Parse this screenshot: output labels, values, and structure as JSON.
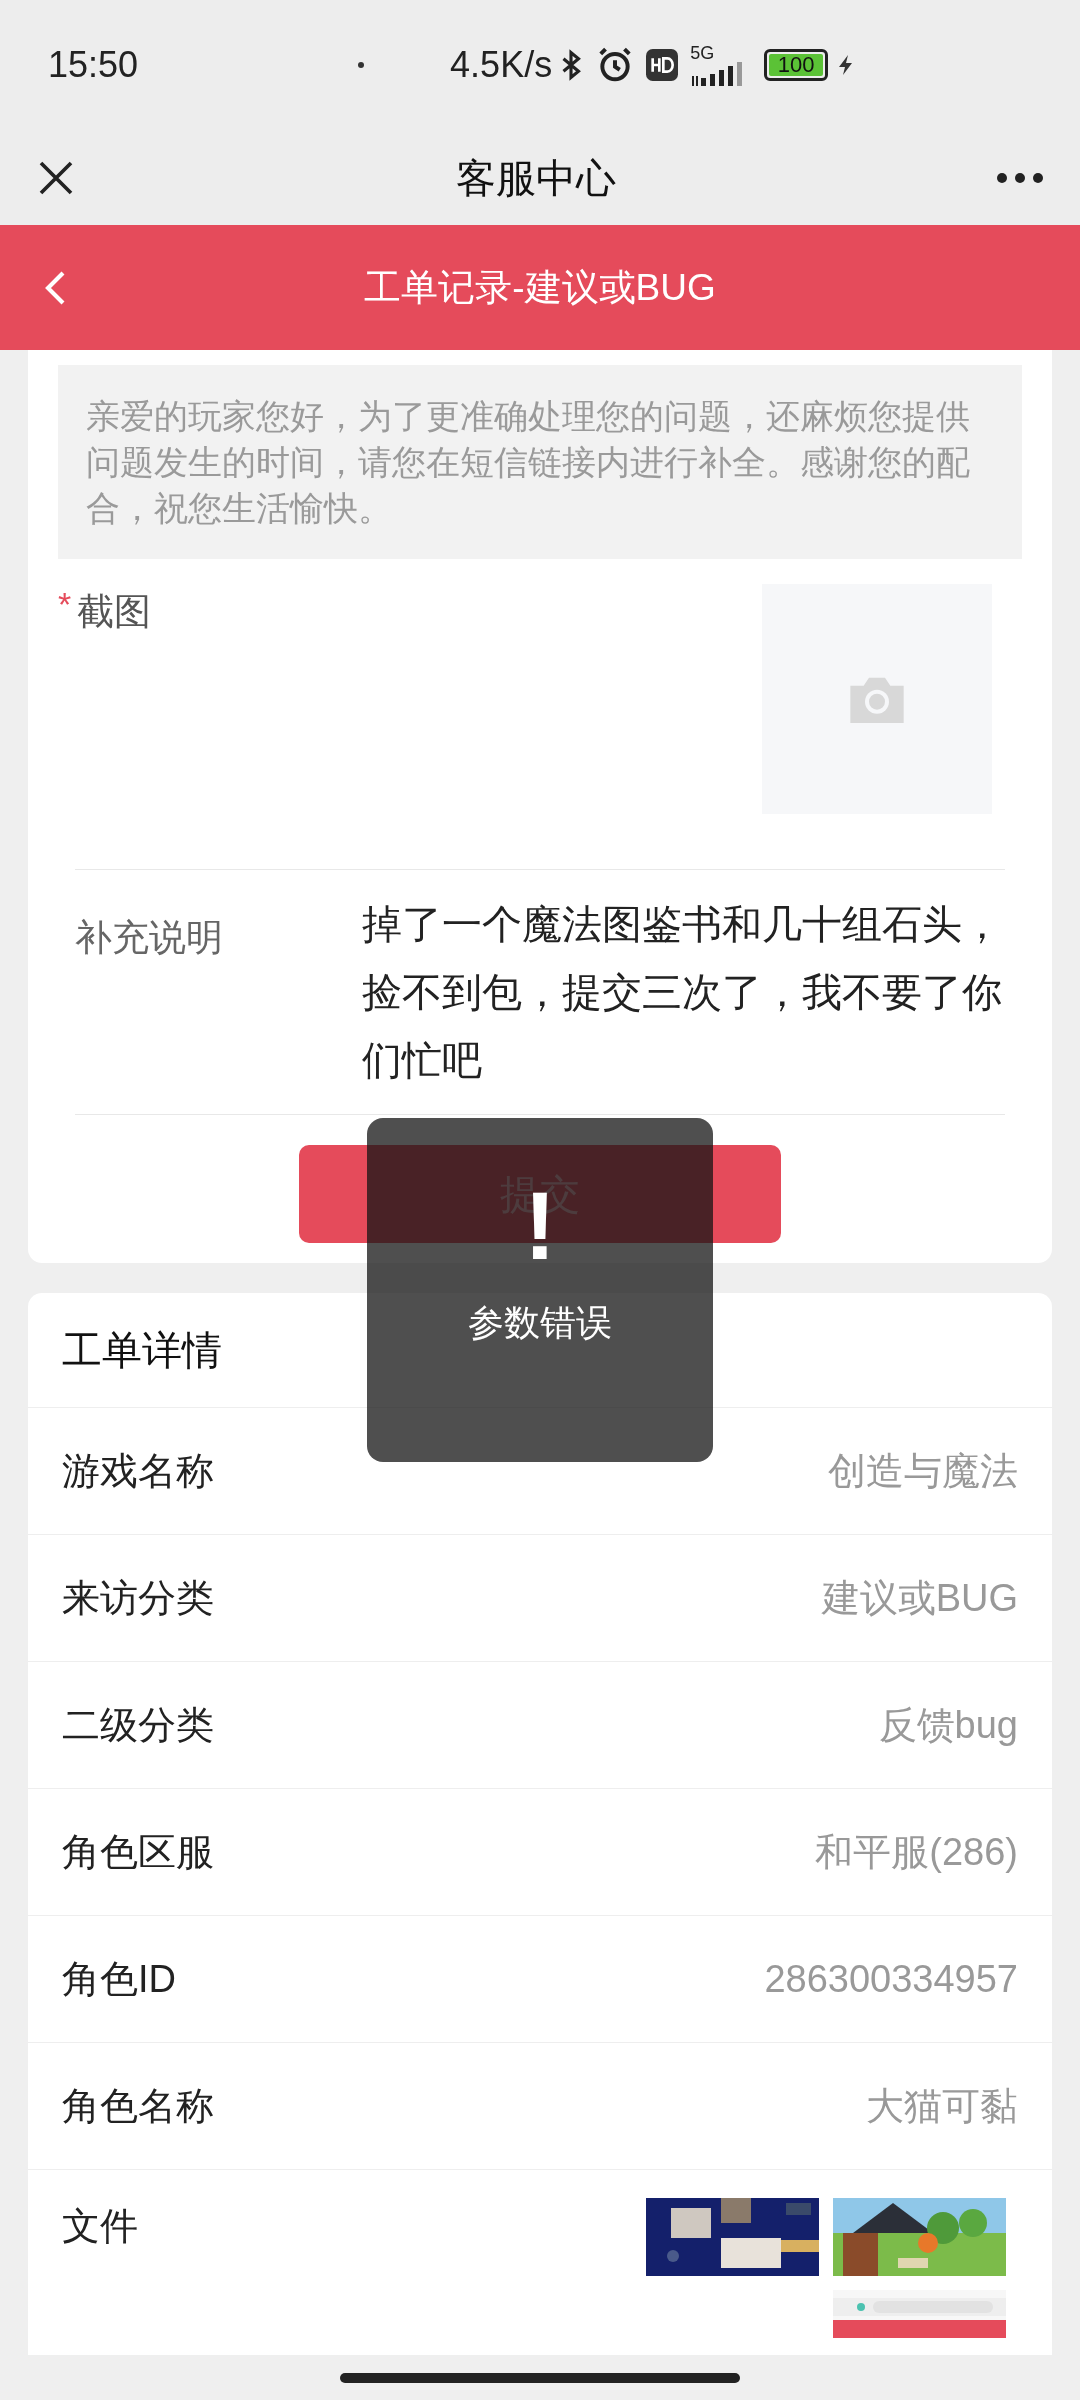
{
  "status_bar": {
    "time": "15:50",
    "network_speed": "4.5K/s",
    "network": "5G",
    "battery": "100"
  },
  "header": {
    "title": "客服中心"
  },
  "banner": {
    "title": "工单记录-建议或BUG"
  },
  "notice": {
    "text": "亲爱的玩家您好，为了更准确处理您的问题，还麻烦您提供问题发生的时间，请您在短信链接内进行补全。感谢您的配合，祝您生活愉快。"
  },
  "screenshot_field": {
    "required_mark": "*",
    "label": "截图"
  },
  "supplement": {
    "label": "补充说明",
    "value": "掉了一个魔法图鉴书和几十组石头，捡不到包，提交三次了，我不要了你们忙吧"
  },
  "submit_button": {
    "label": "提交"
  },
  "toast": {
    "icon": "!",
    "message": "参数错误"
  },
  "details": {
    "title": "工单详情",
    "rows": [
      {
        "label": "游戏名称",
        "value": "创造与魔法"
      },
      {
        "label": "来访分类",
        "value": "建议或BUG"
      },
      {
        "label": "二级分类",
        "value": "反馈bug"
      },
      {
        "label": "角色区服",
        "value": "和平服(286)"
      },
      {
        "label": "角色ID",
        "value": "286300334957"
      },
      {
        "label": "角色名称",
        "value": "大猫可黏"
      }
    ],
    "files": {
      "label": "文件"
    }
  }
}
